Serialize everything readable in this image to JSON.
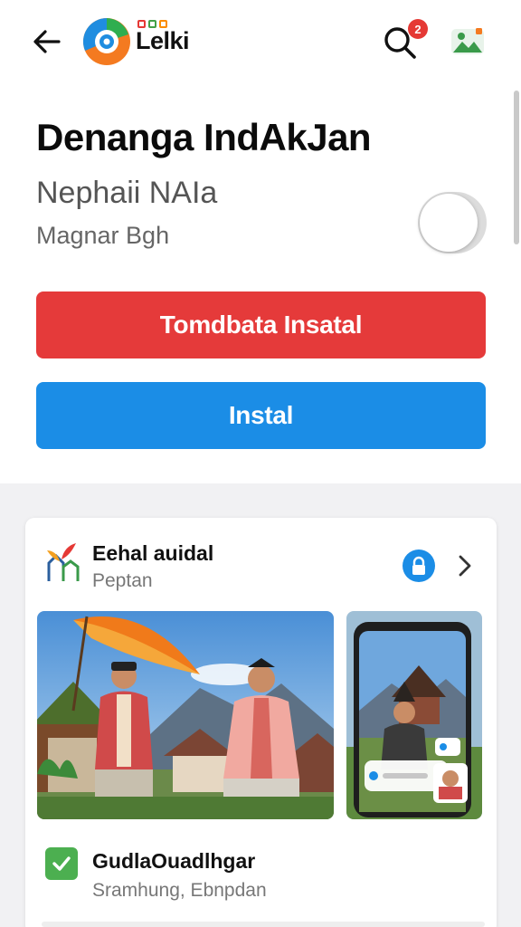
{
  "app_bar": {
    "brand_name": "Lelki",
    "notification_count": "2",
    "icons": {
      "back": "arrow-left-icon",
      "logo": "colorful-circle-logo-icon",
      "search": "search-icon",
      "gallery": "gallery-icon"
    }
  },
  "header": {
    "title": "Denanga IndAkJan",
    "subtitle_primary": "Nephaii NAIa",
    "subtitle_secondary": "Magnar Bgh",
    "toggle_state": "off"
  },
  "actions": {
    "primary_label": "Tomdbata Insatal",
    "secondary_label": "Instal"
  },
  "card": {
    "title": "Eehal auidal",
    "subtitle": "Peptan",
    "item": {
      "title": "GudlaOuadlhgar",
      "subtitle": "Sramhung, Ebnpdan",
      "checked": true
    }
  },
  "colors": {
    "red": "#e53a3a",
    "blue": "#1b8de6",
    "green": "#4caf50",
    "badge": "#e53935"
  }
}
